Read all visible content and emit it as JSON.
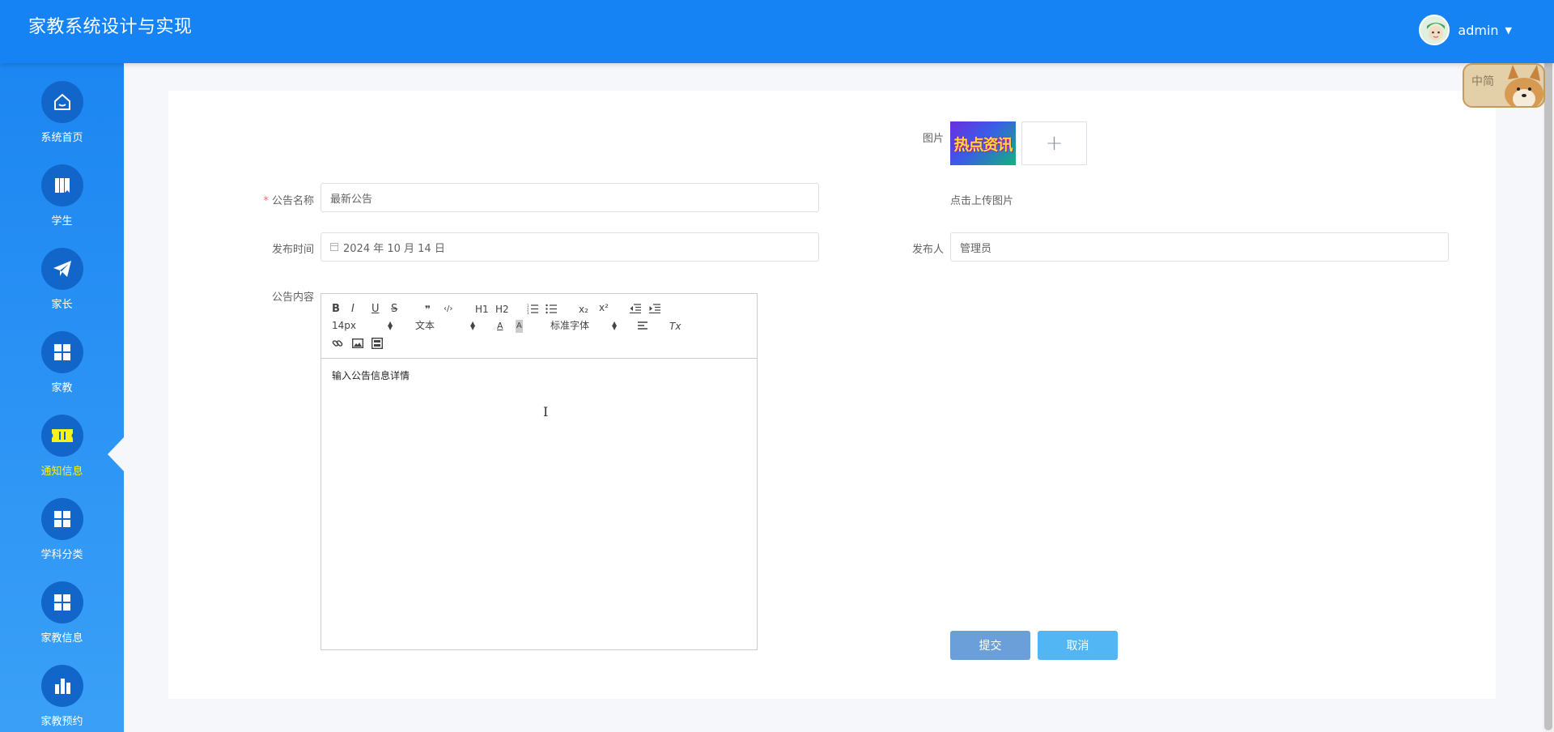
{
  "app": {
    "title": "家教系统设计与实现"
  },
  "user": {
    "name": "admin"
  },
  "sidebar": {
    "items": [
      {
        "label": "系统首页",
        "icon": "home-icon"
      },
      {
        "label": "学生",
        "icon": "book-icon"
      },
      {
        "label": "家长",
        "icon": "paper-plane-icon"
      },
      {
        "label": "家教",
        "icon": "grid-icon"
      },
      {
        "label": "通知信息",
        "icon": "ticket-icon",
        "active": true
      },
      {
        "label": "学科分类",
        "icon": "grid-icon"
      },
      {
        "label": "家教信息",
        "icon": "grid-icon"
      },
      {
        "label": "家教预约",
        "icon": "bar-chart-icon"
      }
    ]
  },
  "form": {
    "image_label": "图片",
    "thumbnail_text": "热点资讯",
    "upload_plus": "+",
    "upload_hint": "点击上传图片",
    "name_label": "公告名称",
    "name_value": "最新公告",
    "time_label": "发布时间",
    "time_value": "2024 年 10 月 14 日",
    "publisher_label": "发布人",
    "publisher_value": "管理员",
    "content_label": "公告内容",
    "content_value": "输入公告信息详情",
    "submit_label": "提交",
    "cancel_label": "取消"
  },
  "editor_toolbar": {
    "bold": "B",
    "italic": "I",
    "underline": "U",
    "strike": "S",
    "blockquote": "❞",
    "code": "‹/›",
    "h1": "H1",
    "h2": "H2",
    "sub": "x₂",
    "sup": "x²",
    "clean": "Tx",
    "size": "14px",
    "header_select": "文本",
    "font_select": "标准字体"
  },
  "mascot": {
    "text": "中简"
  },
  "colors": {
    "header": "#1683f5",
    "sidebar_active_text": "#f5f31e",
    "required_star": "#f56c6c",
    "submit_button": "#6b9fd9",
    "cancel_button": "#52b6f4"
  }
}
